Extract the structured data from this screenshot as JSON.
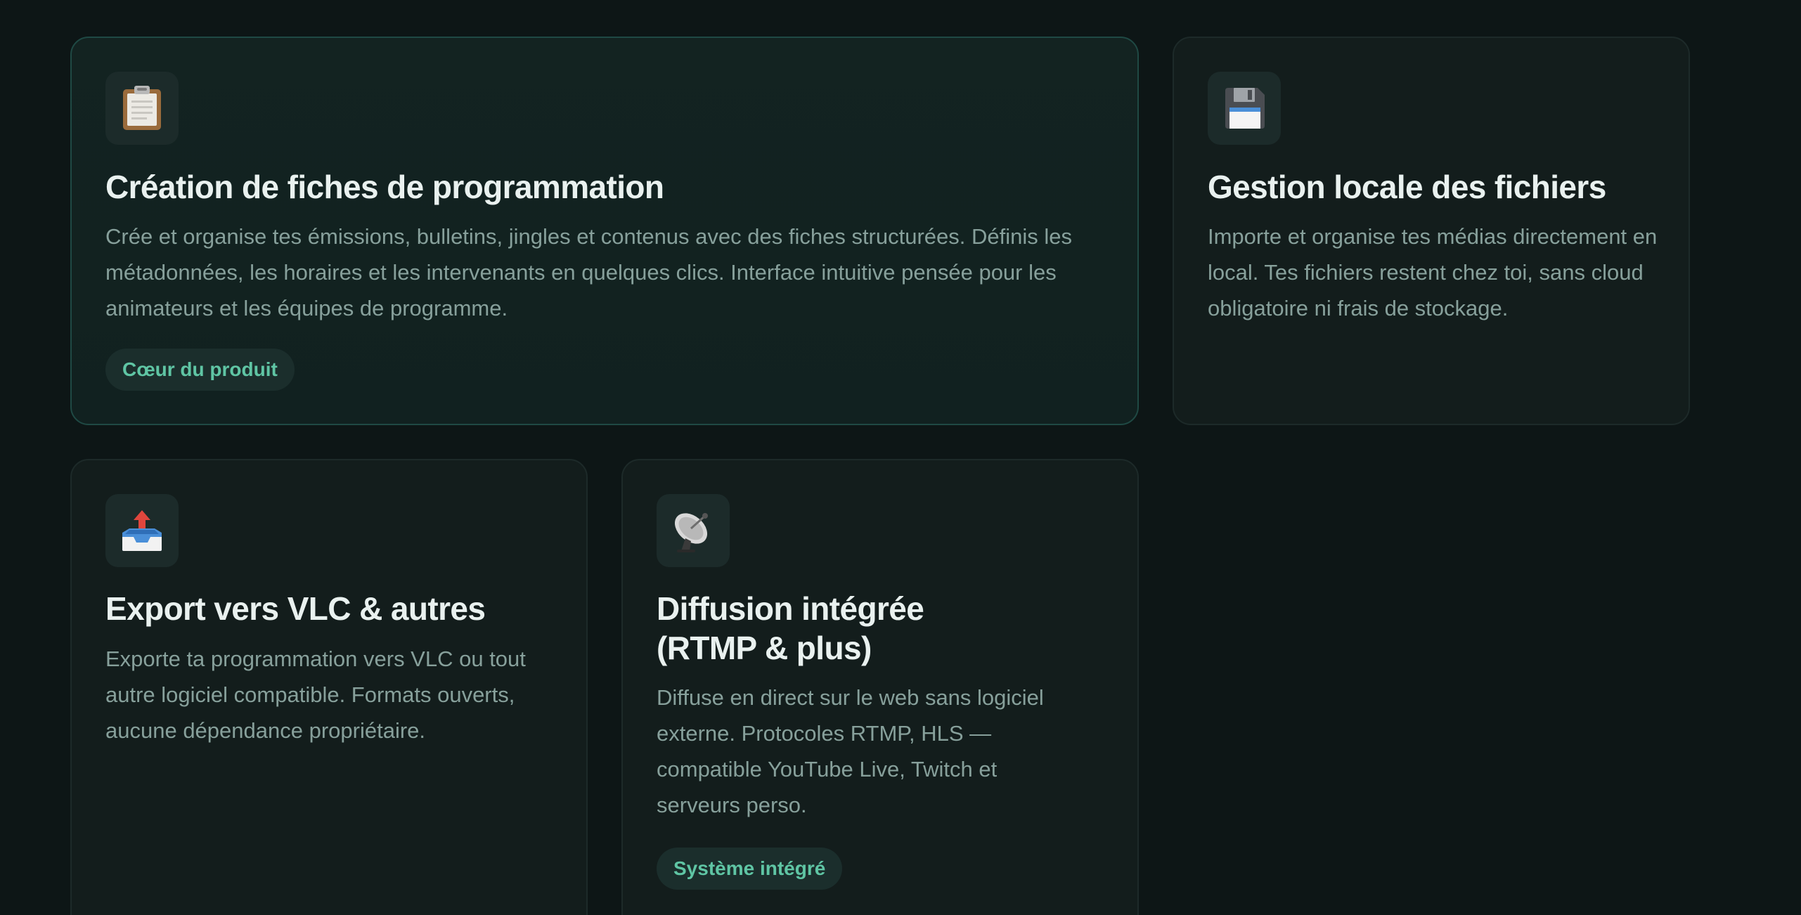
{
  "cards": [
    {
      "icon": "clipboard-icon",
      "title": "Création de fiches de programmation",
      "description": "Crée et organise tes émissions, bulletins, jingles et contenus avec des fiches structurées. Définis les métadonnées, les horaires et les intervenants en quelques clics. Interface intuitive pensée pour les animateurs et les équipes de programme.",
      "badge": "Cœur du produit"
    },
    {
      "icon": "floppy-disk-icon",
      "title": "Gestion locale des fichiers",
      "description": "Importe et organise tes médias directement en local. Tes fichiers restent chez toi, sans cloud obligatoire ni frais de stockage."
    },
    {
      "icon": "outbox-tray-icon",
      "title": "Export vers VLC & autres",
      "description": "Exporte ta programmation vers VLC ou tout autre logiciel compatible. Formats ouverts, aucune dépendance propriétaire."
    },
    {
      "icon": "satellite-dish-icon",
      "title_lines": [
        "Diffusion intégrée",
        "(RTMP & plus)"
      ],
      "description": "Diffuse en direct sur le web sans logiciel externe. Protocoles RTMP, HLS — compatible YouTube Live, Twitch et serveurs perso.",
      "badge": "Système intégré"
    }
  ],
  "colors": {
    "background": "#0d1616",
    "card": "#131d1c",
    "featured_border": "#1f4944",
    "title": "#e9f1ef",
    "description": "#87a09b",
    "badge_text": "#5fc5a4",
    "badge_bg": "#1b2e2c"
  }
}
